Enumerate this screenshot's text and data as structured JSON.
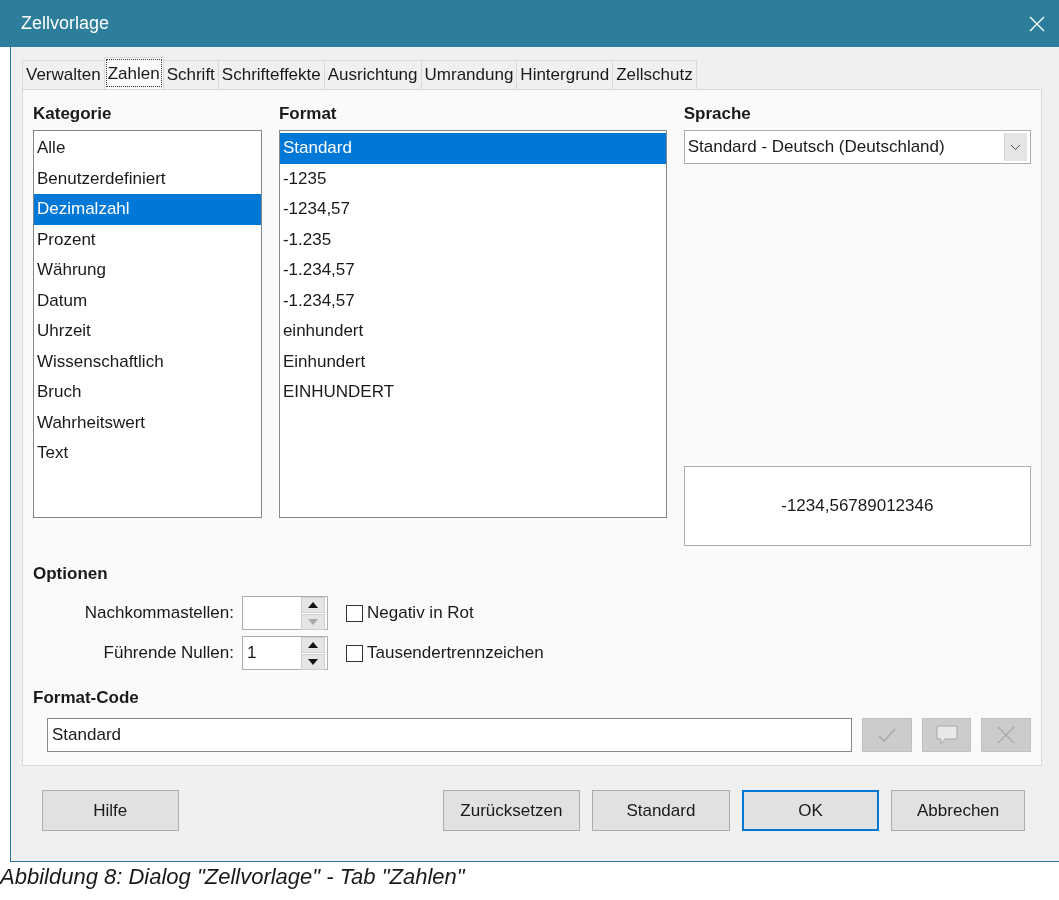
{
  "window": {
    "title": "Zellvorlage"
  },
  "tabs": [
    {
      "label": "Verwalten",
      "selected": false
    },
    {
      "label": "Zahlen",
      "selected": true
    },
    {
      "label": "Schrift",
      "selected": false
    },
    {
      "label": "Schrifteffekte",
      "selected": false
    },
    {
      "label": "Ausrichtung",
      "selected": false
    },
    {
      "label": "Umrandung",
      "selected": false
    },
    {
      "label": "Hintergrund",
      "selected": false
    },
    {
      "label": "Zellschutz",
      "selected": false
    }
  ],
  "kategorie": {
    "label": "Kategorie",
    "items": [
      {
        "label": "Alle",
        "selected": false
      },
      {
        "label": "Benutzerdefiniert",
        "selected": false
      },
      {
        "label": "Dezimalzahl",
        "selected": true
      },
      {
        "label": "Prozent",
        "selected": false
      },
      {
        "label": "Währung",
        "selected": false
      },
      {
        "label": "Datum",
        "selected": false
      },
      {
        "label": "Uhrzeit",
        "selected": false
      },
      {
        "label": "Wissenschaftlich",
        "selected": false
      },
      {
        "label": "Bruch",
        "selected": false
      },
      {
        "label": "Wahrheitswert",
        "selected": false
      },
      {
        "label": "Text",
        "selected": false
      }
    ]
  },
  "format": {
    "label": "Format",
    "items": [
      {
        "label": "Standard",
        "selected": true
      },
      {
        "label": "-1235",
        "selected": false
      },
      {
        "label": "-1234,57",
        "selected": false
      },
      {
        "label": "-1.235",
        "selected": false
      },
      {
        "label": "-1.234,57",
        "selected": false
      },
      {
        "label": "-1.234,57",
        "selected": false
      },
      {
        "label": "einhundert",
        "selected": false
      },
      {
        "label": "Einhundert",
        "selected": false
      },
      {
        "label": "EINHUNDERT",
        "selected": false
      }
    ]
  },
  "sprache": {
    "label": "Sprache",
    "value": "Standard - Deutsch (Deutschland)"
  },
  "preview": {
    "value": "-1234,56789012346"
  },
  "optionen": {
    "label": "Optionen",
    "rows": [
      {
        "label": "Nachkommastellen:",
        "checkbox": "Negativ in Rot",
        "checked": false
      },
      {
        "label": "Führende Nullen:",
        "value": "1",
        "checkbox": "Tausendertrennzeichen",
        "checked": false
      }
    ]
  },
  "format_code": {
    "label": "Format-Code",
    "value": "Standard",
    "buttons": [
      {
        "kind": "check",
        "disabled": true
      },
      {
        "kind": "comment",
        "disabled": true
      },
      {
        "kind": "delete",
        "disabled": true
      }
    ]
  },
  "buttons": [
    {
      "label": "Hilfe",
      "default": false
    },
    {
      "label": "Zurücksetzen",
      "default": false
    },
    {
      "label": "Standard",
      "default": false
    },
    {
      "label": "OK",
      "default": true
    },
    {
      "label": "Abbrechen",
      "default": false
    }
  ],
  "caption": "Abbildung 8: Dialog \"Zellvorlage\" - Tab \"Zahlen\""
}
